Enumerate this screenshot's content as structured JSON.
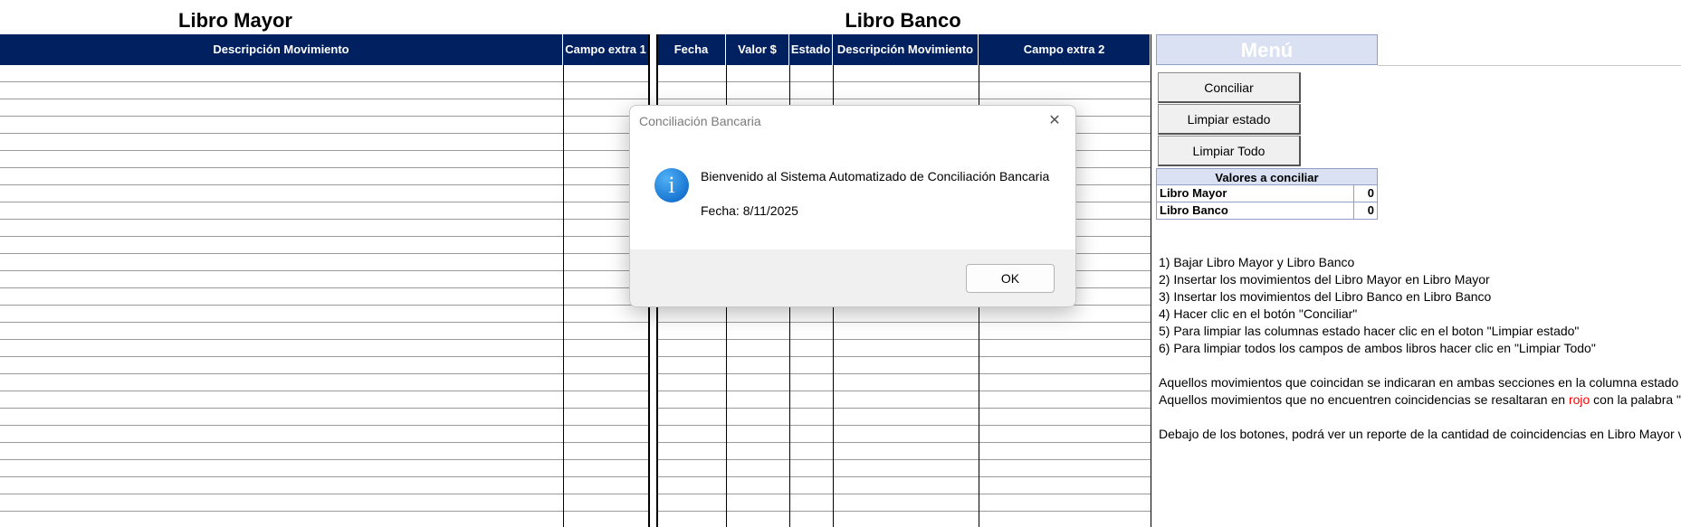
{
  "libro_mayor": {
    "title": "Libro Mayor",
    "columns": [
      "Descripción Movimiento",
      "Campo extra 1"
    ]
  },
  "libro_banco": {
    "title": "Libro Banco",
    "columns": [
      "Fecha",
      "Valor $",
      "Estado",
      "Descripción Movimiento",
      "Campo extra 2"
    ]
  },
  "menu": {
    "title": "Menú",
    "buttons": [
      "Conciliar",
      "Limpiar estado",
      "Limpiar Todo"
    ]
  },
  "valores": {
    "title": "Valores a conciliar",
    "rows": [
      {
        "label": "Libro Mayor",
        "value": "0"
      },
      {
        "label": "Libro Banco",
        "value": "0"
      }
    ]
  },
  "instructions": {
    "steps": [
      "1) Bajar Libro Mayor y Libro Banco",
      "2) Insertar los movimientos del Libro Mayor en Libro Mayor",
      "3) Insertar los movimientos del Libro Banco en Libro Banco",
      "4) Hacer clic en el botón \"Conciliar\"",
      "5) Para limpiar las columnas estado hacer clic en el boton \"Limpiar estado\"",
      "6) Para limpiar todos  los campos de ambos libros hacer clic en \"Limpiar Todo\""
    ],
    "note1": "Aquellos movimientos que coincidan se indicaran en ambas secciones en la columna estado co",
    "note2_pre": "Aquellos movimientos que no encuentren coincidencias se resaltaran en ",
    "note2_red": "rojo",
    "note2_post": " con la palabra \"N",
    "note3": "Debajo de los botones, podrá ver un reporte de la cantidad de coincidencias en Libro Mayor vs"
  },
  "dialog": {
    "title": "Conciliación Bancaria",
    "icon": "info-icon",
    "message": "Bienvenido al Sistema Automatizado de Conciliación Bancaria",
    "date_line": "Fecha: 8/11/2025",
    "ok_label": "OK",
    "close_glyph": "✕"
  },
  "colors": {
    "header_bg": "#002060",
    "menu_title_bg": "#d9e1f2",
    "info_icon": "#1976d2"
  }
}
